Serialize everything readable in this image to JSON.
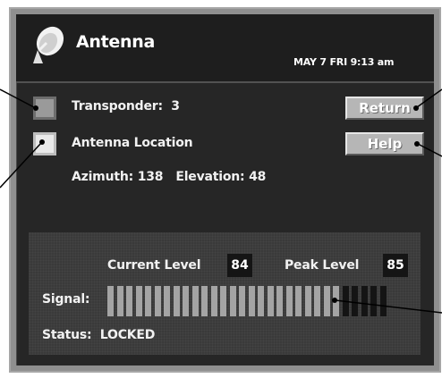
{
  "window": {
    "title": "Antenna",
    "datetime": "MAY  7 FRI  9:13 am"
  },
  "options": {
    "transponder_label": "Transponder:",
    "transponder_value": "3",
    "transponder_checked": false,
    "location_label": "Antenna Location",
    "location_checked": true,
    "azimuth_label": "Azimuth:",
    "azimuth_value": "138",
    "elevation_label": "Elevation:",
    "elevation_value": "48"
  },
  "buttons": {
    "return_label": "Return",
    "help_label": "Help"
  },
  "signal": {
    "current_label": "Current Level",
    "current_value": "84",
    "peak_label": "Peak Level",
    "peak_value": "85",
    "signal_label": "Signal:",
    "status_label": "Status:",
    "status_value": "LOCKED",
    "meter_level_percent": 84
  },
  "colors": {
    "screen_bg": "#262626",
    "frame": "#8f8f8f",
    "button_face": "#b6b6b6",
    "meter_on": "#a4a4a4",
    "meter_off": "#141414"
  },
  "icons": {
    "app_icon": "satellite-dish-icon"
  }
}
